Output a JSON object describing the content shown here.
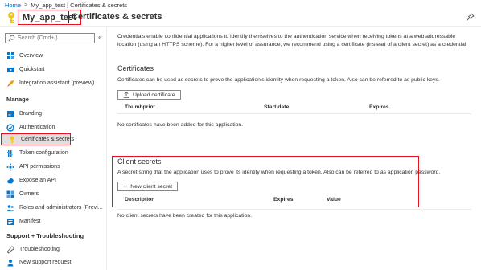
{
  "breadcrumb": {
    "home": "Home",
    "app_page": "My_app_test | Certificates & secrets",
    "separator": ">"
  },
  "header": {
    "app_name": "My_app_test",
    "page_title": "Certificates & secrets"
  },
  "sidebar": {
    "search_placeholder": "Search (Cmd+/)",
    "collapse_glyph": "«",
    "top_items": [
      {
        "label": "Overview",
        "icon": "grid-icon"
      },
      {
        "label": "Quickstart",
        "icon": "quickstart-icon"
      },
      {
        "label": "Integration assistant (preview)",
        "icon": "rocket-icon"
      }
    ],
    "manage_header": "Manage",
    "manage_items": [
      {
        "label": "Branding",
        "icon": "branding-icon"
      },
      {
        "label": "Authentication",
        "icon": "authentication-icon"
      },
      {
        "label": "Certificates & secrets",
        "icon": "key-icon",
        "active": true
      },
      {
        "label": "Token configuration",
        "icon": "token-icon"
      },
      {
        "label": "API permissions",
        "icon": "api-permissions-icon"
      },
      {
        "label": "Expose an API",
        "icon": "cloud-icon"
      },
      {
        "label": "Owners",
        "icon": "owners-icon"
      },
      {
        "label": "Roles and administrators (Previ...",
        "icon": "roles-icon"
      },
      {
        "label": "Manifest",
        "icon": "manifest-icon"
      }
    ],
    "support_header": "Support + Troubleshooting",
    "support_items": [
      {
        "label": "Troubleshooting",
        "icon": "wrench-icon"
      },
      {
        "label": "New support request",
        "icon": "support-person-icon"
      }
    ]
  },
  "main": {
    "intro_text": "Credentials enable confidential applications to identify themselves to the authentication service when receiving tokens at a web addressable location (using an HTTPS scheme). For a higher level of assurance, we recommend using a certificate (instead of a client secret) as a credential.",
    "certificates": {
      "title": "Certificates",
      "description": "Certificates can be used as secrets to prove the application's identity when requesting a token. Also can be referred to as public keys.",
      "upload_button": "Upload certificate",
      "columns": [
        "Thumbprint",
        "Start date",
        "Expires"
      ],
      "empty_message": "No certificates have been added for this application."
    },
    "client_secrets": {
      "title": "Client secrets",
      "description": "A secret string that the application uses to prove its identity when requesting a token. Also can be referred to as application password.",
      "new_button": "New client secret",
      "new_button_glyph": "+",
      "columns": [
        "Description",
        "Expires",
        "Value"
      ],
      "empty_message": "No client secrets have been created for this application."
    }
  },
  "colors": {
    "highlight_border": "#e81123",
    "link": "#0063b1",
    "active_bg": "#e1dfdd",
    "key_gold": "#f2c811"
  }
}
